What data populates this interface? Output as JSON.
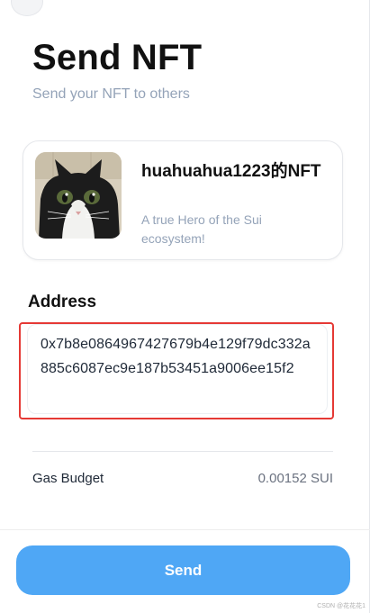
{
  "header": {
    "title": "Send NFT",
    "subtitle": "Send your NFT to others"
  },
  "nft": {
    "name": "huahuahua1223的NFT",
    "description": "A true Hero of the Sui ecosystem!",
    "image_icon": "cat-photo"
  },
  "address": {
    "label": "Address",
    "value": "0x7b8e0864967427679b4e129f79dc332a885c6087ec9e187b53451a9006ee15f2"
  },
  "gas": {
    "label": "Gas Budget",
    "value": "0.00152 SUI"
  },
  "actions": {
    "send_label": "Send"
  },
  "colors": {
    "accent": "#4fa7f5",
    "highlight_border": "#e53935",
    "muted_text": "#94a3b8"
  },
  "watermark": "CSDN @花花花1"
}
